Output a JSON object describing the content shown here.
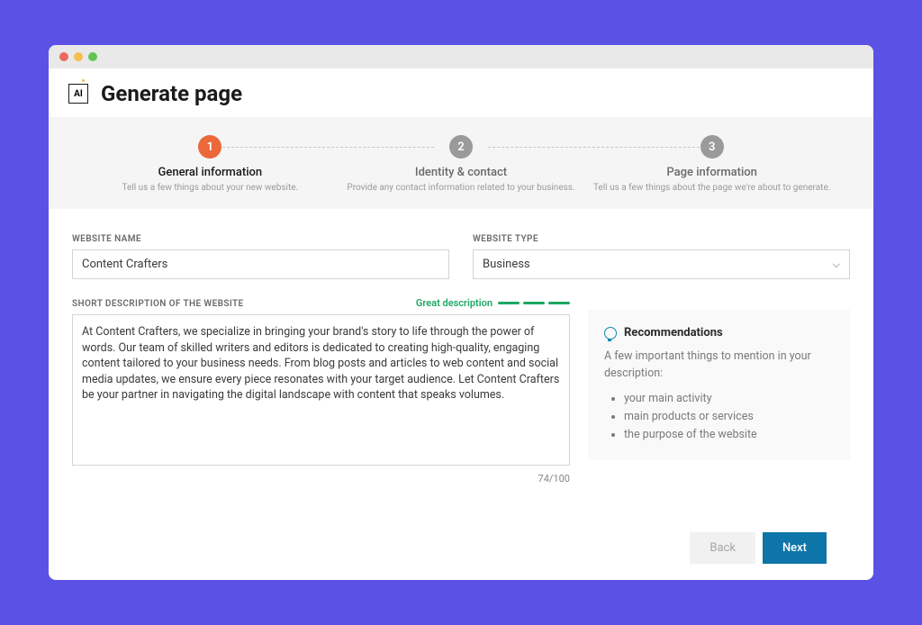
{
  "header": {
    "title": "Generate page",
    "icon_label": "AI"
  },
  "stepper": {
    "steps": [
      {
        "num": "1",
        "title": "General information",
        "sub": "Tell us a few things about your new website."
      },
      {
        "num": "2",
        "title": "Identity & contact",
        "sub": "Provide any contact information related to your business."
      },
      {
        "num": "3",
        "title": "Page information",
        "sub": "Tell us a few things about the page we're about to generate."
      }
    ]
  },
  "form": {
    "website_name_label": "WEBSITE NAME",
    "website_name_value": "Content Crafters",
    "website_type_label": "WEBSITE TYPE",
    "website_type_value": "Business",
    "desc_label": "SHORT DESCRIPTION OF THE WEBSITE",
    "desc_feedback": "Great description",
    "desc_value": "At Content Crafters, we specialize in bringing your brand's story to life through the power of words. Our team of skilled writers and editors is dedicated to creating high-quality, engaging content tailored to your business needs. From blog posts and articles to web content and social media updates, we ensure every piece resonates with your target audience. Let Content Crafters be your partner in navigating the digital landscape with content that speaks volumes.",
    "counter": "74/100"
  },
  "recommendations": {
    "heading": "Recommendations",
    "intro": "A few important things to mention in your description:",
    "items": [
      "your main activity",
      "main products or services",
      "the purpose of the website"
    ]
  },
  "buttons": {
    "back": "Back",
    "next": "Next"
  }
}
